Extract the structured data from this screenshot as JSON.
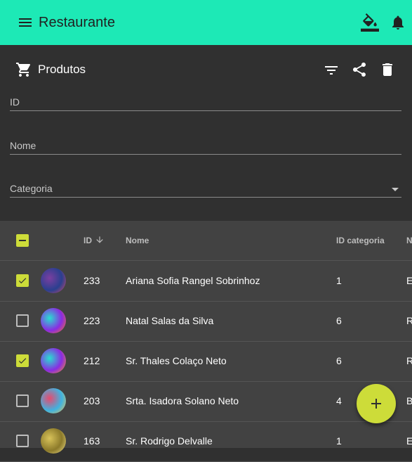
{
  "appbar": {
    "title": "Restaurante",
    "background": "#1de9b6",
    "icons": [
      "menu-icon",
      "format-color-fill-icon",
      "notifications-icon"
    ]
  },
  "panel": {
    "title": "Produtos",
    "icons": [
      "shopping-cart-icon",
      "filter-list-icon",
      "share-icon",
      "delete-icon"
    ]
  },
  "filters": {
    "id_label": "ID",
    "nome_label": "Nome",
    "categoria_label": "Categoria"
  },
  "table": {
    "columns": [
      "ID",
      "Nome",
      "ID categoria",
      "N"
    ],
    "sort_indicator": "arrow-downward-icon",
    "rows": [
      {
        "id": "233",
        "nome": "Ariana Sofia Rangel Sobrinhoz",
        "categoria": "1",
        "extra": "E",
        "checked": true,
        "avatar_colors": [
          "#7b3fa0",
          "#2a3f8f",
          "#d24a6a"
        ]
      },
      {
        "id": "223",
        "nome": "Natal Salas da Silva",
        "categoria": "6",
        "extra": "R",
        "checked": false,
        "avatar_colors": [
          "#27e0d0",
          "#8a2be2",
          "#ff7a18"
        ]
      },
      {
        "id": "212",
        "nome": "Sr. Thales Colaço Neto",
        "categoria": "6",
        "extra": "R",
        "checked": true,
        "avatar_colors": [
          "#27e0d0",
          "#8a2be2",
          "#ff9a18"
        ]
      },
      {
        "id": "203",
        "nome": "Srta. Isadora Solano Neto",
        "categoria": "4",
        "extra": "B",
        "checked": false,
        "avatar_colors": [
          "#e84a6f",
          "#3fb3e0",
          "#f2c14e"
        ]
      },
      {
        "id": "163",
        "nome": "Sr. Rodrigo Delvalle",
        "categoria": "1",
        "extra": "E",
        "checked": false,
        "avatar_colors": [
          "#d8c35a",
          "#8c7a2a",
          "#f0e08a"
        ]
      }
    ]
  },
  "accent": "#cddc39"
}
